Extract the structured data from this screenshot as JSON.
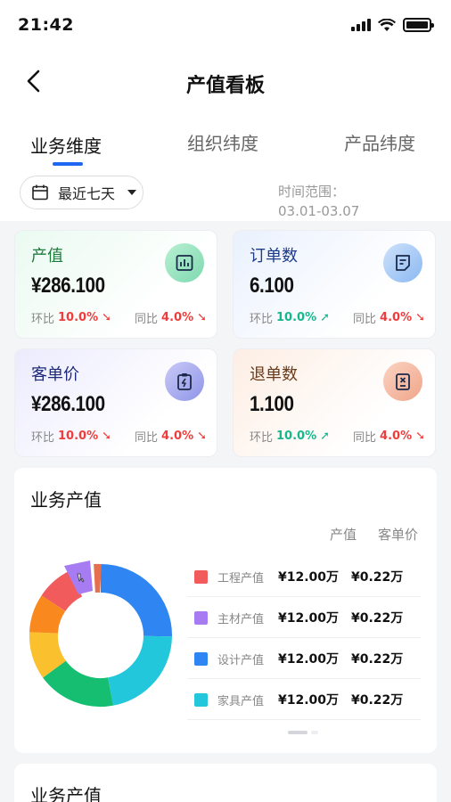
{
  "status_bar": {
    "time": "21:42"
  },
  "header": {
    "title": "产值看板"
  },
  "tabs": [
    {
      "label": "业务维度",
      "active": true
    },
    {
      "label": "组织纬度",
      "active": false
    },
    {
      "label": "产品纬度",
      "active": false
    }
  ],
  "filter": {
    "date_label": "最近七天",
    "range_label": "时间范围：",
    "range_value": "03.01-03.07"
  },
  "cards": [
    {
      "title": "产值",
      "value": "¥286.100",
      "mom_label": "环比",
      "mom_value": "10.0%",
      "mom_trend": "down",
      "yoy_label": "同比",
      "yoy_value": "4.0%",
      "yoy_trend": "down",
      "icon": "bar-chart-icon",
      "title_color": "#1e7a3c"
    },
    {
      "title": "订单数",
      "value": "6.100",
      "mom_label": "环比",
      "mom_value": "10.0%",
      "mom_trend": "up",
      "yoy_label": "同比",
      "yoy_value": "4.0%",
      "yoy_trend": "down",
      "icon": "note-icon",
      "title_color": "#1d3c8a"
    },
    {
      "title": "客单价",
      "value": "¥286.100",
      "mom_label": "环比",
      "mom_value": "10.0%",
      "mom_trend": "down",
      "yoy_label": "同比",
      "yoy_value": "4.0%",
      "yoy_trend": "down",
      "icon": "clipboard-bolt-icon",
      "title_color": "#1d2a7a"
    },
    {
      "title": "退单数",
      "value": "1.100",
      "mom_label": "环比",
      "mom_value": "10.0%",
      "mom_trend": "up",
      "yoy_label": "同比",
      "yoy_value": "4.0%",
      "yoy_trend": "down",
      "icon": "cancel-doc-icon",
      "title_color": "#6a3b1a"
    }
  ],
  "business_panel": {
    "title": "业务产值",
    "col_value": "产值",
    "col_avg": "客单价",
    "legend": [
      {
        "name": "工程产值",
        "value": "¥12.00万",
        "avg": "¥0.22万",
        "color": "#f25b5b"
      },
      {
        "name": "主材产值",
        "value": "¥12.00万",
        "avg": "¥0.22万",
        "color": "#a77cf3"
      },
      {
        "name": "设计产值",
        "value": "¥12.00万",
        "avg": "¥0.22万",
        "color": "#2f86f2"
      },
      {
        "name": "家具产值",
        "value": "¥12.00万",
        "avg": "¥0.22万",
        "color": "#23c7db"
      }
    ]
  },
  "business_panel_2": {
    "title": "业务产值"
  },
  "colors": {
    "accent": "#2167f3",
    "up": "#14b88c",
    "down": "#ee3d3d"
  }
}
